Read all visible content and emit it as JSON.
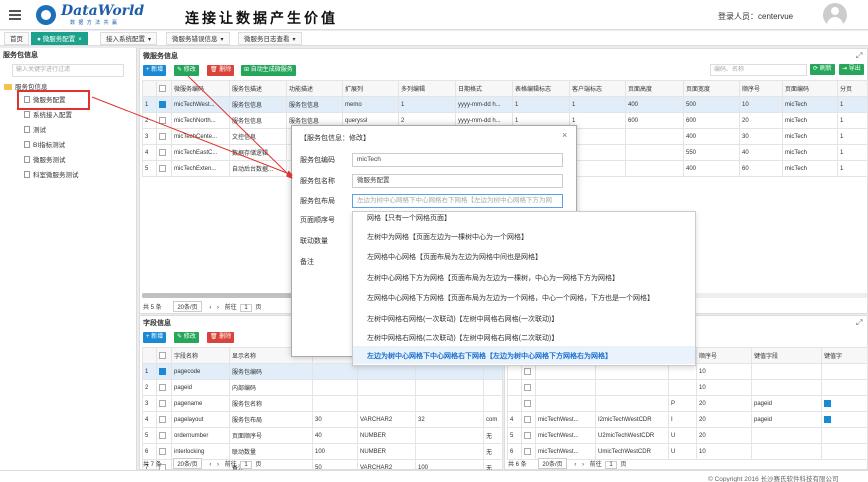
{
  "header": {
    "logo_text": "DataWorld",
    "logo_sub": "数 据 方 法 共 赢",
    "slogan": "连接让数据产生价值",
    "login_label": "登录人员：centervue"
  },
  "tabs": [
    {
      "label": "首页"
    },
    {
      "label": "● 微服务配置",
      "close": "×"
    },
    {
      "label": "接入系统配置",
      "close": "▾"
    },
    {
      "label": "微服务错误信息",
      "close": "▾"
    },
    {
      "label": "微服务日志查看",
      "close": "▾"
    }
  ],
  "left_panel": {
    "title": "服务包信息",
    "search_placeholder": "输入关键字进行过滤",
    "tree": [
      {
        "label": "服务包信息",
        "type": "folder"
      },
      {
        "label": "微服务配置",
        "type": "page"
      },
      {
        "label": "系统接入配置",
        "type": "page"
      },
      {
        "label": "测试",
        "type": "page"
      },
      {
        "label": "BI指标测试",
        "type": "page"
      },
      {
        "label": "微服务测试",
        "type": "page"
      },
      {
        "label": "科室微服务测试",
        "type": "page"
      }
    ]
  },
  "top_panel": {
    "title": "微服务信息",
    "buttons": {
      "add": "+ 新增",
      "edit": "✎ 修改",
      "delete": "🗑 删除",
      "auto": "⊞ 自动生成微服务"
    },
    "search_placeholder": "编码、名称",
    "refresh": "⟳ 刷新",
    "export": "⇥ 导出",
    "columns": [
      "",
      "",
      "微服务编码",
      "服务包描述",
      "功能描述",
      "扩展列",
      "多列编辑",
      "日期格式",
      "表格编辑标志",
      "客户端标志",
      "页面高度",
      "页面宽度",
      "顺序号",
      "页面编码",
      "分页"
    ],
    "rows": [
      [
        "1",
        "on",
        "micTechWest...",
        "服务包信息",
        "服务包信息",
        "memo",
        "1",
        "yyyy-mm-dd h...",
        "1",
        "1",
        "400",
        "500",
        "10",
        "micTech",
        "1"
      ],
      [
        "2",
        "",
        "micTechNorth...",
        "服务包信息",
        "服务包信息",
        "queryssl",
        "2",
        "yyyy-mm-dd h...",
        "1",
        "1",
        "600",
        "600",
        "20",
        "micTech",
        "1"
      ],
      [
        "3",
        "",
        "micTechCente...",
        "文控信息",
        "",
        "",
        "",
        "",
        "",
        "",
        "",
        "400",
        "30",
        "micTech",
        "1"
      ],
      [
        "4",
        "",
        "micTechEastC...",
        "数据存储逻辑",
        "",
        "",
        "",
        "",
        "",
        "",
        "",
        "550",
        "40",
        "micTech",
        "1"
      ],
      [
        "5",
        "",
        "micTechExten...",
        "自动后台数据...",
        "",
        "",
        "",
        "",
        "",
        "",
        "",
        "400",
        "60",
        "micTech",
        "1"
      ]
    ],
    "pager": {
      "total": "共 5 条",
      "per_page": "20条/页",
      "goto": "前往",
      "page": "1",
      "page_suffix": "页"
    }
  },
  "bottom_left_panel": {
    "title": "字段信息",
    "buttons": {
      "add": "+ 新增",
      "edit": "✎ 修改",
      "delete": "🗑 删除"
    },
    "columns": [
      "",
      "",
      "字段名称",
      "显示名称",
      "",
      "",
      "",
      ""
    ],
    "rows": [
      [
        "1",
        "on",
        "pagecode",
        "服务包编码",
        "",
        "",
        "",
        ""
      ],
      [
        "2",
        "",
        "pageid",
        "内部编码",
        "",
        "",
        "",
        ""
      ],
      [
        "3",
        "",
        "pagename",
        "服务包名称",
        "",
        "",
        "",
        ""
      ],
      [
        "4",
        "",
        "pagelayout",
        "服务包布局",
        "30",
        "VARCHAR2",
        "32",
        "com"
      ],
      [
        "5",
        "",
        "ordernumber",
        "页面顺序号",
        "40",
        "NUMBER",
        "",
        "无"
      ],
      [
        "6",
        "",
        "interlocking",
        "联动数量",
        "100",
        "NUMBER",
        "",
        "无"
      ],
      [
        "7",
        "",
        "memo",
        "备注",
        "50",
        "VARCHAR2",
        "100",
        "无"
      ]
    ],
    "pager": {
      "total": "共 7 条",
      "per_page": "20条/页",
      "goto": "前往",
      "page": "1",
      "page_suffix": "页"
    }
  },
  "bottom_right_panel": {
    "columns": [
      "",
      "",
      "",
      "",
      "",
      "顺序号",
      "键值字段",
      "键值字"
    ],
    "rows": [
      [
        "",
        "",
        "",
        "",
        "",
        "10",
        "",
        ""
      ],
      [
        "",
        "",
        "",
        "",
        "",
        "10",
        "",
        ""
      ],
      [
        "",
        "",
        "",
        "",
        "P",
        "20",
        "pageid",
        "on"
      ],
      [
        "4",
        "",
        "micTechWest...",
        "I2micTechWestCDR",
        "I",
        "20",
        "pageid",
        "on"
      ],
      [
        "5",
        "",
        "micTechWest...",
        "U2micTechWestCDR",
        "U",
        "20",
        "",
        ""
      ],
      [
        "6",
        "",
        "micTechWest...",
        "UmicTechWestCDR",
        "U",
        "10",
        "",
        ""
      ]
    ],
    "pager": {
      "total": "共 6 条",
      "per_page": "20条/页",
      "goto": "前往",
      "page": "1",
      "page_suffix": "页"
    }
  },
  "modal": {
    "title": "【服务包信息：修改】",
    "close": "×",
    "fields": [
      {
        "label": "服务包编码",
        "value": "micTech"
      },
      {
        "label": "服务包名称",
        "value": "微服务配置"
      },
      {
        "label": "服务包布局",
        "value": "左边为树中心网格下中心网格右下网格【左边为树中心网格下方为网"
      },
      {
        "label": "页面顺序号",
        "value": ""
      },
      {
        "label": "联动数量",
        "value": ""
      },
      {
        "label": "备注",
        "value": ""
      }
    ]
  },
  "dropdown": {
    "items": [
      "网格【只有一个网格页面】",
      "左树中为网格【页面左边为一棵树中心为一个网格】",
      "左网格中心网格【页面布局为左边为网格中间也是网格】",
      "左树中心网格下方为网格【页面布局为左边为一棵树，中心为一网格下方为网格】",
      "左网格中心网格下方网格【页面布局为左边为一个网格，中心一个网格，下方也是一个网格】",
      "左树中网格右网格(一次联动)【左树中网格右网格(一次联动)】",
      "左树中网格右网格(二次联动)【左树中网格右网格(二次联动)】",
      "左边为树中心网格下中心网格右下网格【左边为树中心网格下方网格右为网格】"
    ]
  },
  "footer": {
    "copyright": "© Copyright 2016 长沙赛氏软件科技有限公司"
  },
  "colors": {
    "accent": "#1ca18b",
    "primary": "#1a8ad4",
    "danger": "#d9433a",
    "success": "#26a65b",
    "highlight_box": "#e0322e"
  }
}
